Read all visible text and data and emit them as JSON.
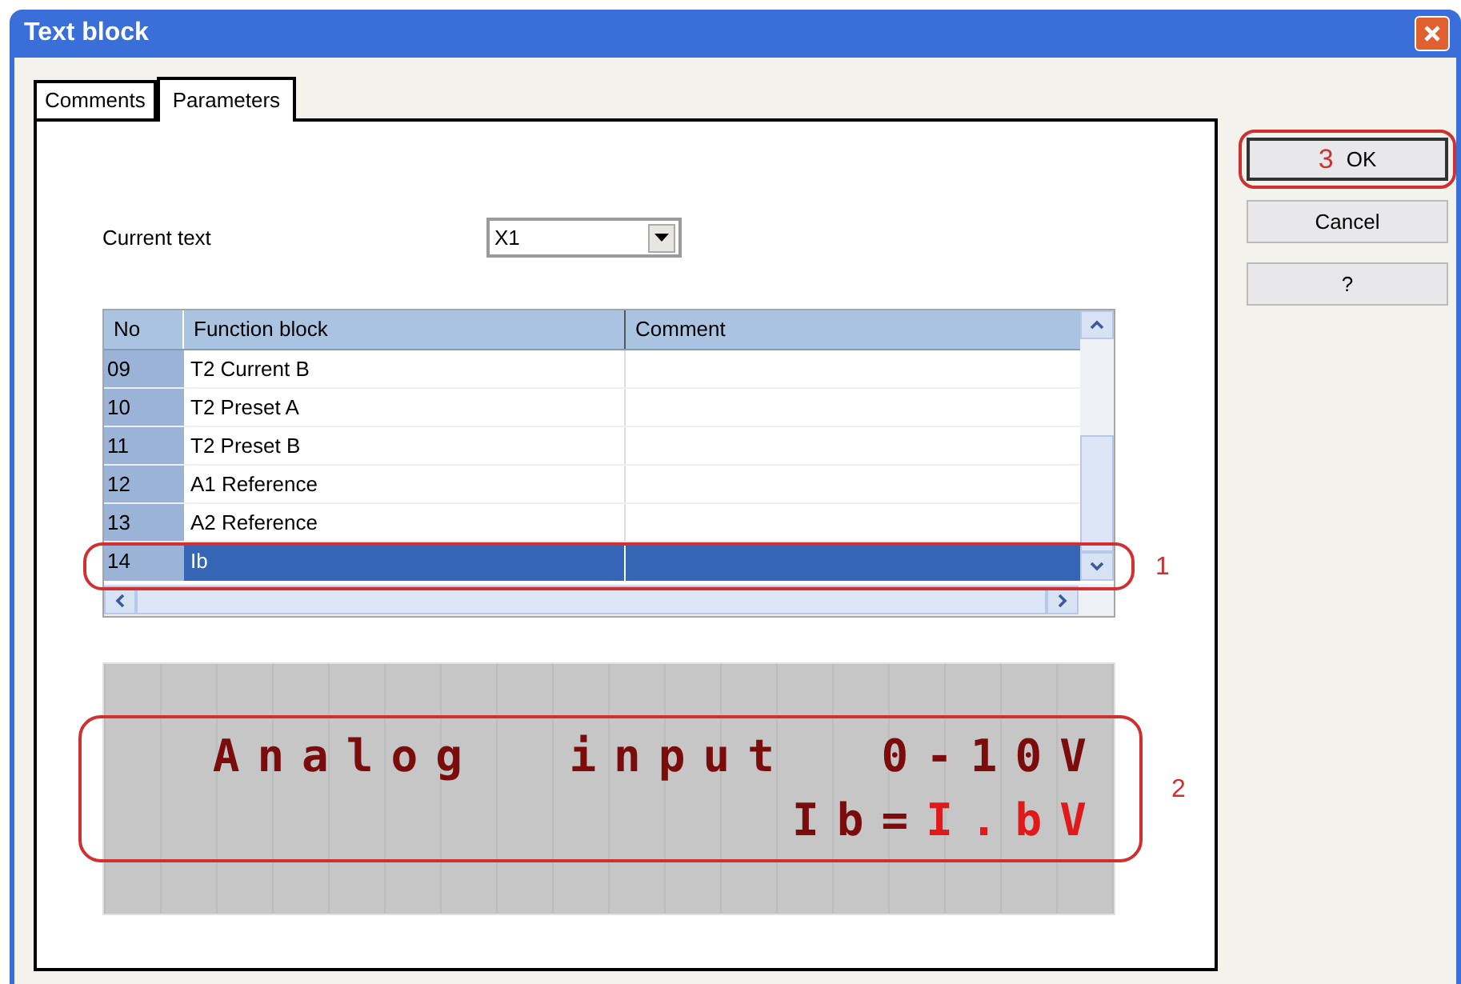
{
  "window": {
    "title": "Text block"
  },
  "tabs": [
    {
      "label": "Comments",
      "selected": false
    },
    {
      "label": "Parameters",
      "selected": true
    }
  ],
  "current_text": {
    "label": "Current text",
    "value": "X1"
  },
  "table": {
    "columns": [
      "No",
      "Function block",
      "Comment"
    ],
    "rows": [
      {
        "no": "09",
        "function_block": "T2 Current B",
        "selected": false
      },
      {
        "no": "10",
        "function_block": "T2 Preset A",
        "selected": false
      },
      {
        "no": "11",
        "function_block": "T2 Preset B",
        "selected": false
      },
      {
        "no": "12",
        "function_block": "A1 Reference",
        "selected": false
      },
      {
        "no": "13",
        "function_block": "A2 Reference",
        "selected": false
      },
      {
        "no": "14",
        "function_block": "Ib",
        "selected": true
      }
    ],
    "callout": "1"
  },
  "lcd": {
    "lines": [
      [
        {
          "text": "Analog  input  0-10V",
          "highlight": false
        }
      ],
      [
        {
          "text": "Ib=",
          "highlight": false
        },
        {
          "text": "I.bV",
          "highlight": true
        }
      ]
    ],
    "callout": "2"
  },
  "buttons": [
    {
      "label": "OK",
      "callout": "3"
    },
    {
      "label": "Cancel"
    },
    {
      "label": "?"
    }
  ]
}
